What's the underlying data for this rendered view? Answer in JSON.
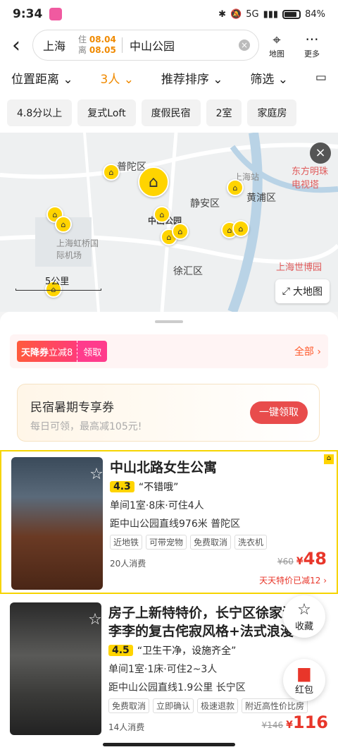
{
  "status": {
    "time": "9:34",
    "network": "5G",
    "battery": "84%"
  },
  "search": {
    "city": "上海",
    "checkin_label": "住",
    "checkin": "08.04",
    "checkout_label": "离",
    "checkout": "08.05",
    "keyword": "中山公园"
  },
  "top_actions": {
    "map": "地图",
    "more": "更多"
  },
  "filters": {
    "location": "位置距离",
    "guests": "3人",
    "sort": "推荐排序",
    "filter": "筛选"
  },
  "chips": [
    "4.8分以上",
    "复式Loft",
    "度假民宿",
    "2室",
    "家庭房"
  ],
  "map": {
    "labels": {
      "putuo": "普陀区",
      "jingan": "静安区",
      "huangpu": "黄浦区",
      "xuhui": "徐汇区",
      "zsgy": "中山公园",
      "shanghai_station": "上海站",
      "hongqiao": "上海虹桥国际机场",
      "oriental": "东方明珠电视塔",
      "expo": "上海世博园"
    },
    "scale": "5公里",
    "big_map": "大地图"
  },
  "coupon": {
    "title": "天降券",
    "desc": "立减8",
    "claim": "领取",
    "all": "全部"
  },
  "promo": {
    "title": "民宿暑期专享券",
    "sub": "每日可领，最高减105元!",
    "button": "一键领取"
  },
  "listings": [
    {
      "title": "中山北路女生公寓",
      "score": "4.3",
      "review": "“不错哦”",
      "rooms": "单间1室·8床·可住4人",
      "distance": "距中山公园直线976米 普陀区",
      "tags": [
        "近地铁",
        "可带宠物",
        "免费取消",
        "洗衣机"
      ],
      "consumed": "20人消费",
      "old_price": "¥60",
      "price": "48",
      "discount": "天天特价已减12"
    },
    {
      "title": "房子上新特特价，长宁区徐家汇李李的复古侘寂风格+法式浪漫",
      "score": "4.5",
      "review": "“卫生干净，设施齐全”",
      "rooms": "单间1室·1床·可住2~3人",
      "distance": "距中山公园直线1.9公里 长宁区",
      "tags": [
        "免费取消",
        "立即确认",
        "极速退款",
        "附近高性价比房"
      ],
      "consumed": "14人消费",
      "old_price": "¥146",
      "price": "116"
    }
  ],
  "floating": {
    "favorite": "收藏",
    "red_packet": "红包"
  }
}
